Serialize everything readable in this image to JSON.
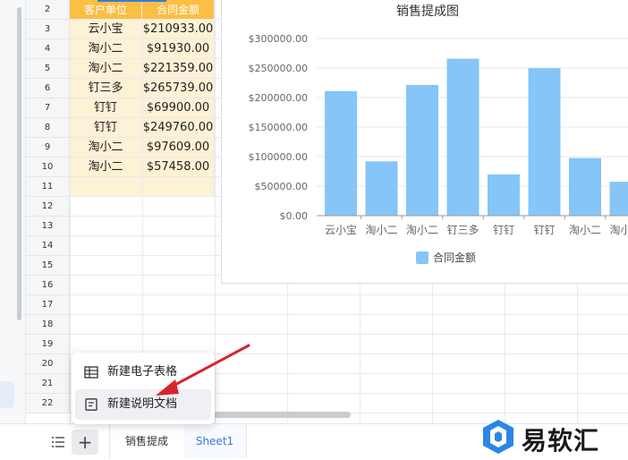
{
  "spreadsheet": {
    "row_numbers": [
      "2",
      "3",
      "4",
      "5",
      "6",
      "7",
      "8",
      "9",
      "10",
      "11",
      "12",
      "13",
      "14",
      "15",
      "16",
      "17",
      "18",
      "19",
      "20",
      "21",
      "22"
    ],
    "header": {
      "name": "客户单位",
      "amount": "合同金额"
    },
    "rows": [
      {
        "name": "云小宝",
        "amount": "$210933.00"
      },
      {
        "name": "淘小二",
        "amount": "$91930.00"
      },
      {
        "name": "淘小二",
        "amount": "$221359.00"
      },
      {
        "name": "钉三多",
        "amount": "$265739.00"
      },
      {
        "name": "钉钉",
        "amount": "$69900.00"
      },
      {
        "name": "钉钉",
        "amount": "$249760.00"
      },
      {
        "name": "淘小二",
        "amount": "$97609.00"
      },
      {
        "name": "淘小二",
        "amount": "$57458.00"
      }
    ]
  },
  "chart_data": {
    "type": "bar",
    "title": "销售提成图",
    "categories": [
      "云小宝",
      "淘小二",
      "淘小二",
      "钉三多",
      "钉钉",
      "钉钉",
      "淘小二",
      "淘小二"
    ],
    "series": [
      {
        "name": "合同金额",
        "values": [
          210933,
          91930,
          221359,
          265739,
          69900,
          249760,
          97609,
          57458
        ],
        "color": "#86c5f7"
      }
    ],
    "category_labels_visible": [
      "云小宝",
      "淘小二",
      "淘小二",
      "钉三多",
      "钉钉",
      "钉钉",
      "淘小二",
      "淘小二"
    ],
    "ylim": [
      0,
      300000
    ],
    "yticks": [
      "$0.00",
      "$50000.00",
      "$100000.00",
      "$150000.00",
      "$200000.00",
      "$250000.00",
      "$300000.00"
    ],
    "grid": true,
    "legend_position": "bottom-center"
  },
  "popup_menu": {
    "items": [
      {
        "label": "新建电子表格",
        "icon": "table-icon"
      },
      {
        "label": "新建说明文档",
        "icon": "document-icon"
      }
    ]
  },
  "bottom_bar": {
    "list_icon": "list-icon",
    "add_label": "+",
    "tabs": [
      {
        "label": "销售提成",
        "active": false
      },
      {
        "label": "Sheet1",
        "active": true
      }
    ]
  },
  "watermark": {
    "text": "易软汇"
  },
  "colors": {
    "header_fill": "#fbbf44",
    "cell_fill": "#fdf1d6",
    "bar": "#86c5f7",
    "accent": "#3a7bd5",
    "arrow": "#d9232d"
  }
}
